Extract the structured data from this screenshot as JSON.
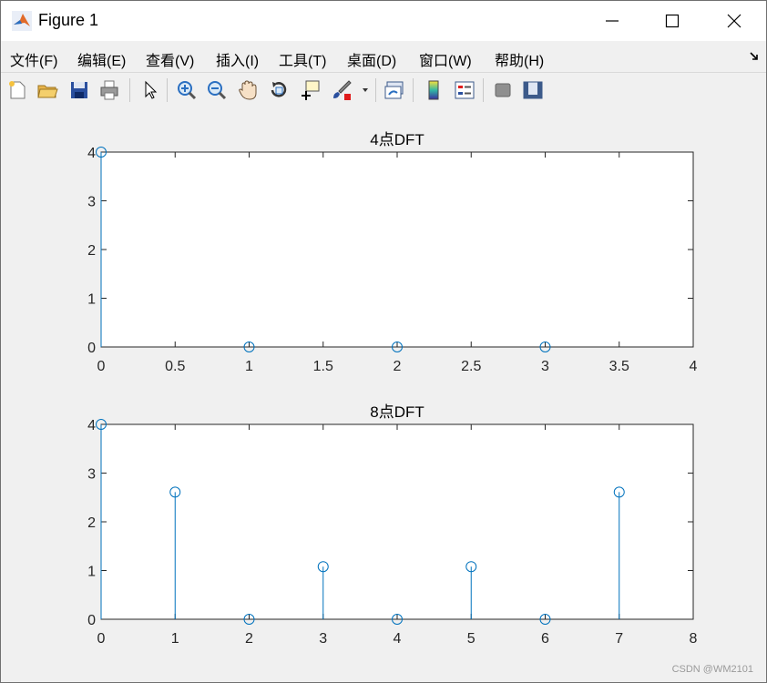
{
  "window": {
    "title": "Figure 1",
    "minimize_icon": "minimize-icon",
    "maximize_icon": "maximize-icon",
    "close_icon": "close-icon"
  },
  "menu": {
    "items": [
      "文件(F)",
      "编辑(E)",
      "查看(V)",
      "插入(I)",
      "工具(T)",
      "桌面(D)",
      "窗口(W)",
      "帮助(H)"
    ]
  },
  "toolbar": {
    "icons": [
      "new-figure-icon",
      "open-file-icon",
      "save-icon",
      "print-icon",
      "pointer-icon",
      "zoom-in-icon",
      "zoom-out-icon",
      "pan-icon",
      "rotate-3d-icon",
      "data-cursor-icon",
      "brush-icon",
      "brush-dropdown-icon",
      "link-plot-icon",
      "colorbar-icon",
      "legend-icon",
      "hide-plot-tools-icon",
      "show-plot-tools-icon"
    ]
  },
  "watermark": "CSDN @WM2101",
  "colors": {
    "stem": "#0072BD",
    "axes": "#262626",
    "figure_bg": "#f0f0f0"
  },
  "chart_data": [
    {
      "type": "stem",
      "title": "4点DFT",
      "x": [
        0,
        1,
        2,
        3
      ],
      "y": [
        4,
        0,
        0,
        0
      ],
      "xlim": [
        0,
        4
      ],
      "ylim": [
        0,
        4
      ],
      "xticks": [
        "0",
        "0.5",
        "1",
        "1.5",
        "2",
        "2.5",
        "3",
        "3.5",
        "4"
      ],
      "xtick_values": [
        0,
        0.5,
        1,
        1.5,
        2,
        2.5,
        3,
        3.5,
        4
      ],
      "yticks": [
        "0",
        "1",
        "2",
        "3",
        "4"
      ],
      "ytick_values": [
        0,
        1,
        2,
        3,
        4
      ],
      "grid": false
    },
    {
      "type": "stem",
      "title": "8点DFT",
      "x": [
        0,
        1,
        2,
        3,
        4,
        5,
        6,
        7
      ],
      "y": [
        4,
        2.61,
        0,
        1.08,
        0,
        1.08,
        0,
        2.61
      ],
      "xlim": [
        0,
        8
      ],
      "ylim": [
        0,
        4
      ],
      "xticks": [
        "0",
        "1",
        "2",
        "3",
        "4",
        "5",
        "6",
        "7",
        "8"
      ],
      "xtick_values": [
        0,
        1,
        2,
        3,
        4,
        5,
        6,
        7,
        8
      ],
      "yticks": [
        "0",
        "1",
        "2",
        "3",
        "4"
      ],
      "ytick_values": [
        0,
        1,
        2,
        3,
        4
      ],
      "grid": false
    }
  ]
}
